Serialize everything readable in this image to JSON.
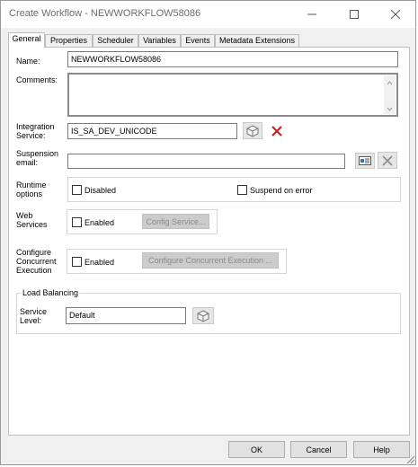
{
  "window": {
    "title": "Create Workflow - NEWWORKFLOW58086"
  },
  "tabs": [
    {
      "label": "General",
      "active": true
    },
    {
      "label": "Properties"
    },
    {
      "label": "Scheduler"
    },
    {
      "label": "Variables"
    },
    {
      "label": "Events"
    },
    {
      "label": "Metadata Extensions"
    }
  ],
  "general": {
    "name_label": "Name:",
    "name_value": "NEWWORKFLOW58086",
    "comments_label": "Comments:",
    "comments_value": "",
    "integration_label_line1": "Integration",
    "integration_label_line2": "Service:",
    "integration_value": "IS_SA_DEV_UNICODE",
    "suspension_label_line1": "Suspension",
    "suspension_label_line2": "email:",
    "suspension_value": "",
    "runtime_label_line1": "Runtime",
    "runtime_label_line2": "options",
    "disabled_label": "Disabled",
    "suspend_on_error_label": "Suspend on error",
    "web_label_line1": "Web",
    "web_label_line2": "Services",
    "web_enabled_label": "Enabled",
    "config_service_label": "Config Service...",
    "concurrent_label_line1": "Configure",
    "concurrent_label_line2": "Concurrent",
    "concurrent_label_line3": "Execution",
    "concurrent_enabled_label": "Enabled",
    "configure_concurrent_label": "Configure Concurrent Execution ...",
    "load_balancing_title": "Load Balancing",
    "service_level_line1": "Service",
    "service_level_line2": "Level:",
    "service_level_value": "Default"
  },
  "footer": {
    "ok_label": "OK",
    "cancel_label": "Cancel",
    "help_label": "Help"
  }
}
